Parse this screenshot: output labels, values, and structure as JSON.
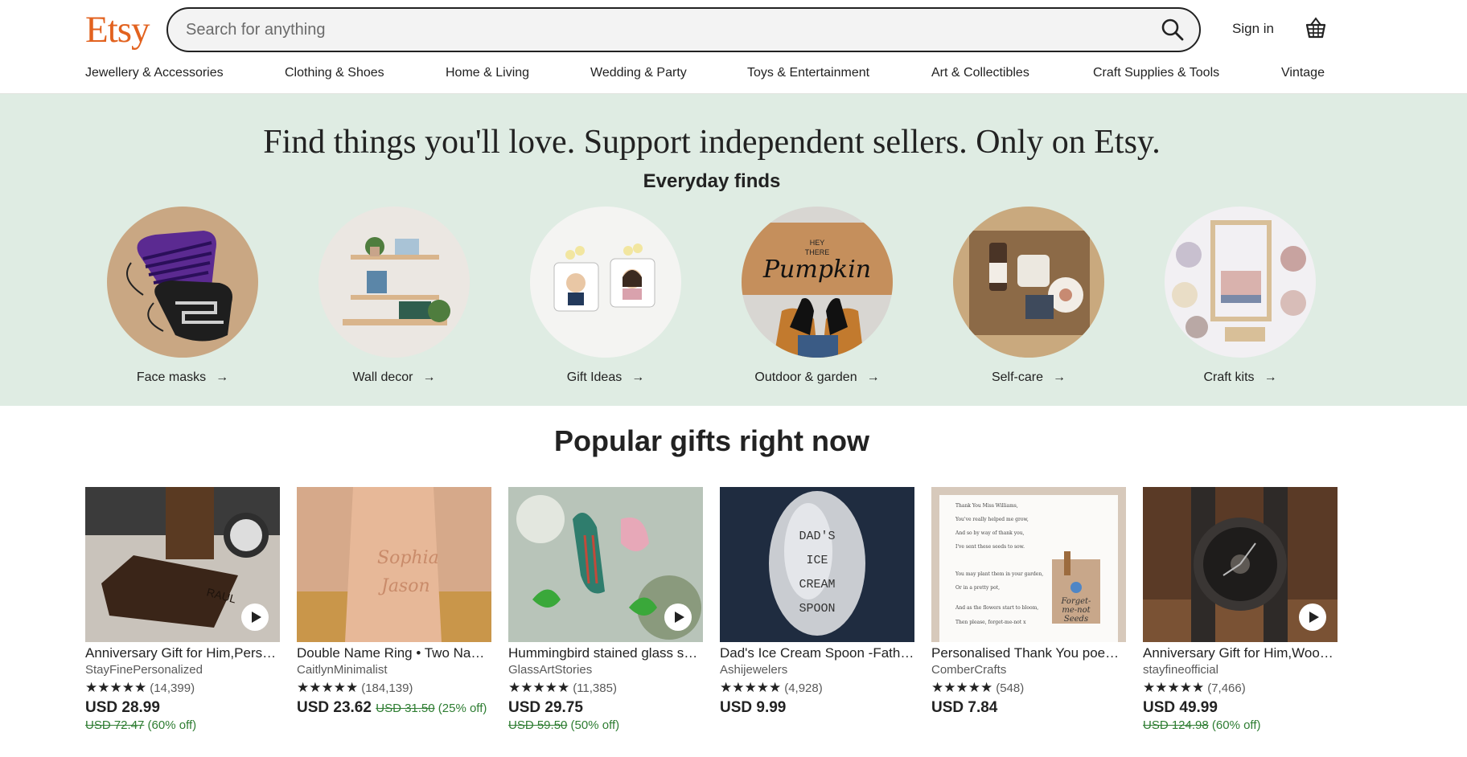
{
  "header": {
    "logo": "Etsy",
    "search_placeholder": "Search for anything",
    "signin": "Sign in"
  },
  "categories": [
    "Jewellery & Accessories",
    "Clothing & Shoes",
    "Home & Living",
    "Wedding & Party",
    "Toys & Entertainment",
    "Art & Collectibles",
    "Craft Supplies & Tools",
    "Vintage"
  ],
  "hero": {
    "title": "Find things you'll love. Support independent sellers. Only on Etsy.",
    "subtitle": "Everyday finds",
    "finds": [
      {
        "label": "Face masks"
      },
      {
        "label": "Wall decor"
      },
      {
        "label": "Gift Ideas"
      },
      {
        "label": "Outdoor & garden"
      },
      {
        "label": "Self-care"
      },
      {
        "label": "Craft kits"
      }
    ]
  },
  "popular": {
    "title": "Popular gifts right now",
    "products": [
      {
        "title": "Anniversary Gift for Him,Personalized Wallet",
        "shop": "StayFinePersonalized",
        "reviews": "(14,399)",
        "price": "USD 28.99",
        "orig": "USD 72.47",
        "disc": "(60% off)",
        "video": true
      },
      {
        "title": "Double Name Ring • Two Name Ring",
        "shop": "CaitlynMinimalist",
        "reviews": "(184,139)",
        "price": "USD 23.62",
        "orig": "USD 31.50",
        "disc": "(25% off)",
        "video": false
      },
      {
        "title": "Hummingbird stained glass suncatcher",
        "shop": "GlassArtStories",
        "reviews": "(11,385)",
        "price": "USD 29.75",
        "orig": "USD 59.50",
        "disc": "(50% off)",
        "video": true
      },
      {
        "title": "Dad's Ice Cream Spoon -Father's Day",
        "shop": "Ashijewelers",
        "reviews": "(4,928)",
        "price": "USD 9.99",
        "orig": "",
        "disc": "",
        "video": false
      },
      {
        "title": "Personalised Thank You poem card",
        "shop": "ComberCrafts",
        "reviews": "(548)",
        "price": "USD 7.84",
        "orig": "",
        "disc": "",
        "video": false
      },
      {
        "title": "Anniversary Gift for Him,Wooden Watch",
        "shop": "stayfineofficial",
        "reviews": "(7,466)",
        "price": "USD 49.99",
        "orig": "USD 124.98",
        "disc": "(60% off)",
        "video": true
      }
    ]
  },
  "image_text": {
    "spoon": [
      "DAD'S",
      "ICE",
      "CREAM",
      "SPOON"
    ],
    "doormat": [
      "HEY",
      "THERE",
      "Pumpkin"
    ],
    "ring": [
      "Sophia",
      "Jason"
    ],
    "wallet": "RAUL",
    "card_lines": [
      "Thank You Miss Williams,",
      "You've really helped me grow,",
      "And so by way of thank you,",
      "I've sent these seeds to sow.",
      "You may plant them in your garden,",
      "Or in a pretty pot,",
      "And as the flowers start to bloom,",
      "Then please, forget-me-not x"
    ],
    "card_tag": [
      "Forget-",
      "me-not",
      "Seeds"
    ]
  },
  "stars": "★★★★★",
  "arrow": "→"
}
